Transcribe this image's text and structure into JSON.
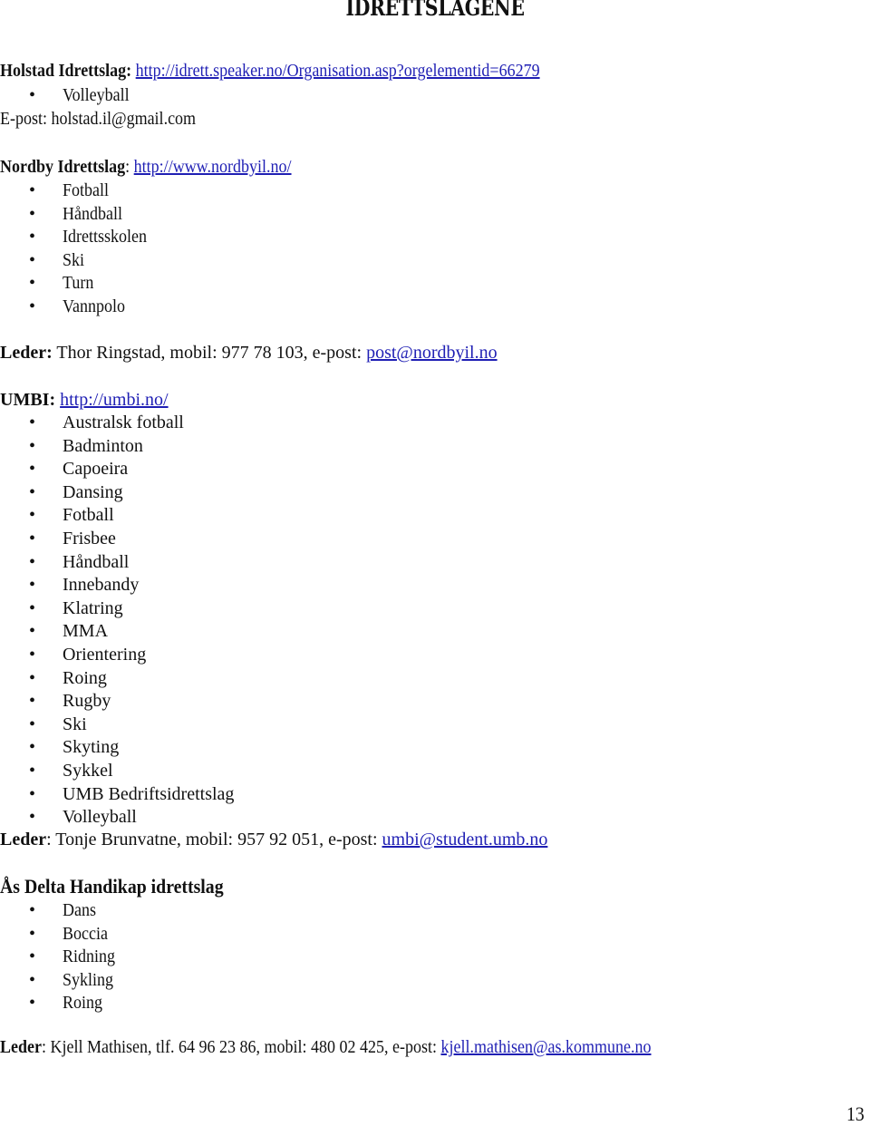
{
  "page": {
    "title": "IDRETTSLAGENE",
    "page_number": "13",
    "link_color": "#1f1fb4"
  },
  "clubs": [
    {
      "name": "Holstad Idrettslag:",
      "url": "http://idrett.speaker.no/Organisation.asp?orgelementid=66279",
      "activities": [
        "Volleyball"
      ],
      "contact": "E-post: holstad.il@gmail.com"
    },
    {
      "name": "Nordby Idrettslag",
      "separator": ":",
      "url": "http://www.nordbyil.no/",
      "activities": [
        "Fotball",
        "Håndball",
        "Idrettsskolen",
        "Ski",
        "Turn",
        "Vannpolo"
      ],
      "leader_label": "Leder:",
      "leader_text": " Thor Ringstad, mobil: 977 78 103, e-post: ",
      "leader_email": "post@nordbyil.no"
    },
    {
      "name": "UMBI:",
      "url": "http://umbi.no/",
      "activities": [
        "Australsk fotball",
        "Badminton",
        "Capoeira",
        "Dansing",
        "Fotball",
        "Frisbee",
        "Håndball",
        "Innebandy",
        "Klatring",
        "MMA",
        "Orientering",
        "Roing",
        "Rugby",
        "Ski",
        "Skyting",
        "Sykkel",
        "UMB Bedriftsidrettslag",
        "Volleyball"
      ],
      "leader_label": "Leder",
      "leader_text": ": Tonje Brunvatne, mobil: 957 92 051, e-post: ",
      "leader_email": "umbi@student.umb.no"
    },
    {
      "name": "Ås Delta Handikap idrettslag",
      "activities": [
        "Dans",
        "Boccia",
        "Ridning",
        "Sykling",
        "Roing"
      ],
      "leader_label": "Leder",
      "leader_text": ": Kjell Mathisen, tlf. 64 96 23 86, mobil: 480 02 425, e-post: ",
      "leader_email": "kjell.mathisen@as.kommune.no"
    }
  ]
}
